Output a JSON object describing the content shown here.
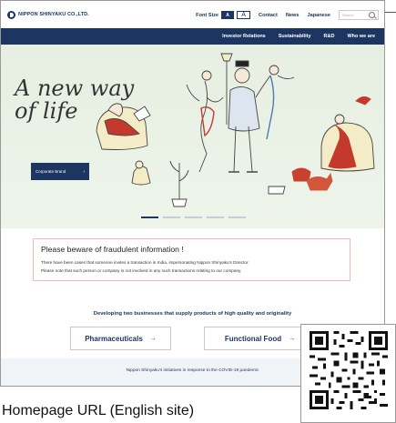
{
  "header": {
    "logo_text": "NIPPON SHINYAKU CO.,LTD.",
    "font_size_label": "Font Size",
    "font_small": "A",
    "font_large": "A",
    "links": [
      "Contact",
      "News",
      "Japanese"
    ],
    "search_placeholder": "Search"
  },
  "nav": {
    "items": [
      "Investor Relations",
      "Sustainability",
      "R&D",
      "Who we are"
    ]
  },
  "hero": {
    "tagline_line1": "A new way",
    "tagline_line2": "of life",
    "cta_label": "Corporate Brand",
    "cta_icon": "arrow-right-icon",
    "slide_count": 5,
    "active_slide": 1
  },
  "notice": {
    "title": "Please beware of fraudulent information !",
    "line1": "There have been cases that someone invites a transaction in India, impersonating Nippon Shinyaku's Director.",
    "line2": "Please note that such person or company is not involved in any such transactions relating to our company."
  },
  "business": {
    "heading": "Developing two businesses that supply products of high quality and originality",
    "buttons": [
      {
        "label": "Pharmaceuticals",
        "icon": "arrow-right-icon"
      },
      {
        "label": "Functional Food",
        "icon": "arrow-right-icon"
      }
    ]
  },
  "covid": {
    "text": "Nippon Shinyaku's initiatives in response to the COVID-19 pandemic"
  },
  "caption": {
    "text": "Homepage URL (English site)"
  },
  "colors": {
    "brand_navy": "#1d3561",
    "hero_bg": "#e6efe2",
    "notice_border": "#e8bfb7"
  }
}
